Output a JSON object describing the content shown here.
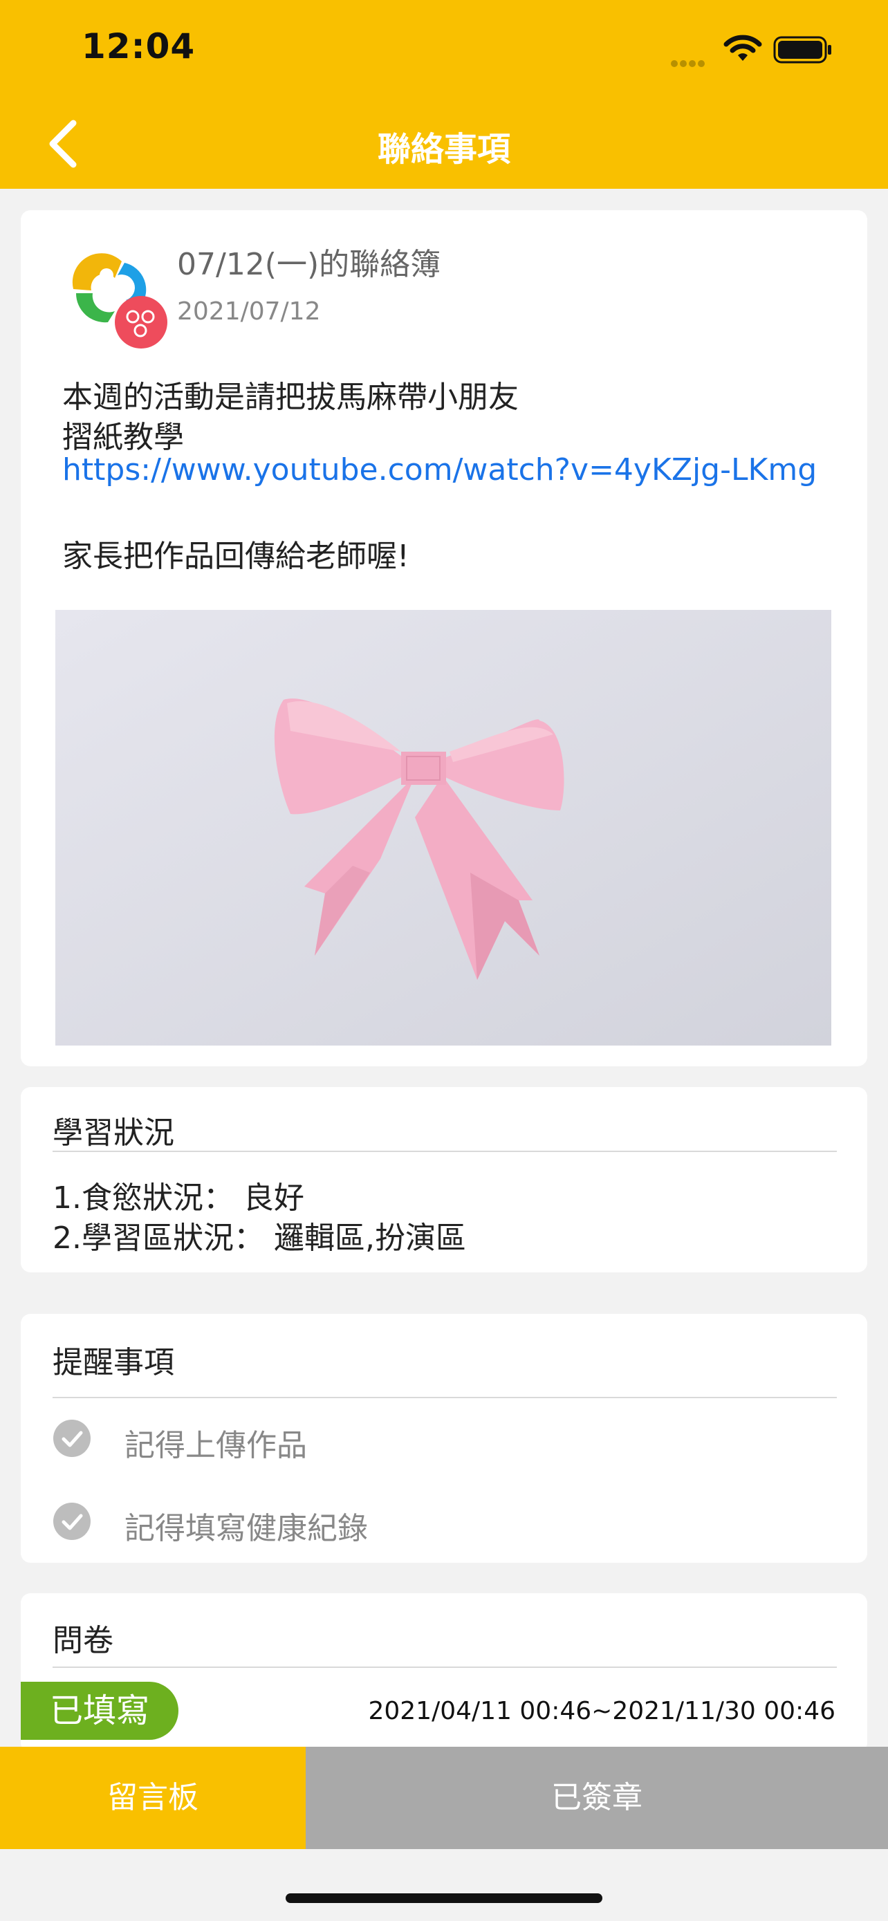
{
  "status_bar": {
    "time": "12:04"
  },
  "header": {
    "title": "聯絡事項"
  },
  "post": {
    "title": "07/12(一)的聯絡簿",
    "date": "2021/07/12",
    "line1": "本週的活動是請把拔馬麻帶小朋友",
    "line2": "摺紙教學",
    "link": "https://www.youtube.com/watch?v=4yKZjg-LKmg",
    "line3": "家長把作品回傳給老師喔!"
  },
  "learning": {
    "title": "學習狀況",
    "items": [
      "1.食慾狀況： 良好",
      "2.學習區狀況： 邏輯區,扮演區"
    ]
  },
  "reminders": {
    "title": "提醒事項",
    "items": [
      {
        "label": "記得上傳作品",
        "icon": "check-circle-icon"
      },
      {
        "label": "記得填寫健康紀錄",
        "icon": "check-circle-icon"
      }
    ]
  },
  "survey": {
    "title": "問卷",
    "status": "已填寫",
    "date_range": "2021/04/11 00:46~2021/11/30 00:46"
  },
  "bottom_bar": {
    "message_board": "留言板",
    "signed": "已簽章"
  },
  "colors": {
    "brand_yellow": "#f9c000",
    "link_blue": "#1a73e8",
    "status_green": "#6db01f",
    "disabled_gray": "#a9a9a9"
  }
}
